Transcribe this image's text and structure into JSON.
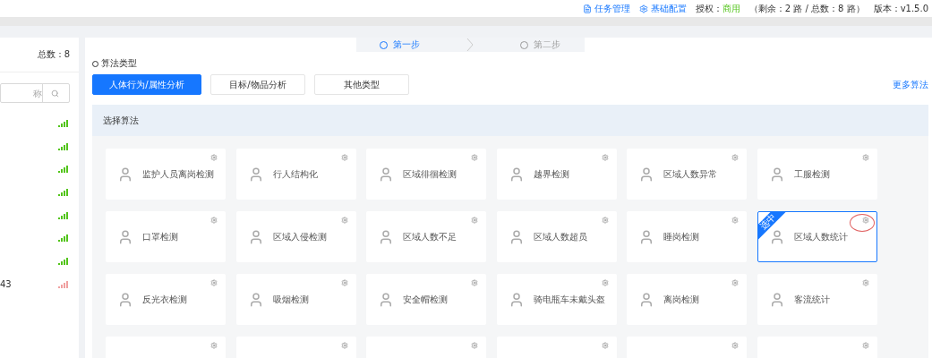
{
  "header": {
    "links": [
      {
        "label": "任务管理",
        "kind": "file"
      },
      {
        "label": "基础配置",
        "kind": "gear"
      }
    ],
    "license_label": "授权：",
    "license_value": "商用",
    "license_detail": "（剩余：2 路 / 总数：8 路）",
    "version": "版本：v1.5.0"
  },
  "sidebar": {
    "total": "总数：8",
    "search": {
      "placeholder": "称"
    },
    "items": [
      {
        "color": "#52c41a"
      },
      {
        "color": "#52c41a"
      },
      {
        "color": "#52c41a"
      },
      {
        "color": "#52c41a"
      },
      {
        "color": "#52c41a"
      },
      {
        "color": "#52c41a"
      },
      {
        "color": "#52c41a"
      },
      {
        "text": "43",
        "color": "#f0a0a0"
      }
    ]
  },
  "steps": [
    {
      "label": "第一步",
      "selected": true
    },
    {
      "label": "第二步",
      "selected": false
    }
  ],
  "algorithm_type": {
    "title": "算法类型",
    "tabs": [
      {
        "label": "人体行为/属性分析",
        "selected": true
      },
      {
        "label": "目标/物品分析",
        "selected": false
      },
      {
        "label": "其他类型",
        "selected": false
      }
    ],
    "more": "更多算法"
  },
  "panel": {
    "title": "选择算法",
    "cards": [
      {
        "label": "监护人员离岗检测",
        "selected": false
      },
      {
        "label": "行人结构化",
        "selected": false
      },
      {
        "label": "区域徘徊检测",
        "selected": false
      },
      {
        "label": "越界检测",
        "selected": false
      },
      {
        "label": "区域人数异常",
        "selected": false
      },
      {
        "label": "工服检测",
        "selected": false
      },
      {
        "label": "口罩检测",
        "selected": false
      },
      {
        "label": "区域入侵检测",
        "selected": false
      },
      {
        "label": "区域人数不足",
        "selected": false
      },
      {
        "label": "区域人数超员",
        "selected": false
      },
      {
        "label": "睡岗检测",
        "selected": false
      },
      {
        "label": "区域人数统计",
        "selected": true,
        "ribbon": "选中",
        "annotated": true
      },
      {
        "label": "反光衣检测",
        "selected": false
      },
      {
        "label": "吸烟检测",
        "selected": false
      },
      {
        "label": "安全帽检测",
        "selected": false
      },
      {
        "label": "骑电瓶车未戴头盔",
        "selected": false
      },
      {
        "label": "离岗检测",
        "selected": false
      },
      {
        "label": "客流统计",
        "selected": false
      },
      {
        "selected": false
      },
      {
        "selected": false
      },
      {
        "selected": false
      },
      {
        "selected": false
      },
      {
        "selected": false
      },
      {
        "selected": false
      }
    ]
  }
}
